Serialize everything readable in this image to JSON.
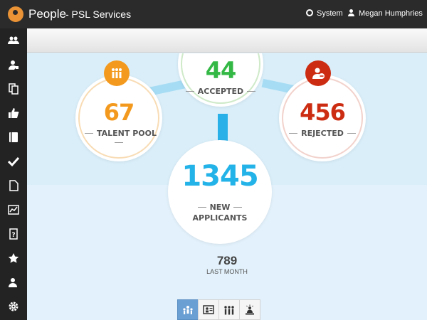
{
  "header": {
    "app_name": "People",
    "org_name": "- PSL Services",
    "system_label": "System",
    "user_name": "Megan Humphries"
  },
  "sidebar": {
    "items": [
      {
        "icon": "users-group-icon"
      },
      {
        "icon": "user-settings-icon"
      },
      {
        "icon": "copy-documents-icon"
      },
      {
        "icon": "thumbs-up-icon"
      },
      {
        "icon": "book-icon"
      },
      {
        "icon": "checkmark-icon"
      },
      {
        "icon": "document-icon"
      },
      {
        "icon": "line-chart-icon"
      },
      {
        "icon": "help-document-icon"
      },
      {
        "icon": "star-icon"
      },
      {
        "icon": "user-add-icon"
      },
      {
        "icon": "gear-icon"
      }
    ]
  },
  "stats": {
    "accepted": {
      "value": "44",
      "label": "ACCEPTED",
      "color": "#33b845"
    },
    "talent_pool": {
      "value": "67",
      "label": "TALENT POOL",
      "color": "#f39a1e"
    },
    "rejected": {
      "value": "456",
      "label": "REJECTED",
      "color": "#cc2d12"
    },
    "new_applicants": {
      "value": "1345",
      "label_line1": "NEW",
      "label_line2": "APPLICANTS",
      "color": "#24b3e8"
    },
    "last_month": {
      "value": "789",
      "label": "LAST MONTH"
    }
  },
  "view_buttons": [
    {
      "icon": "applicants-view-icon",
      "active": true
    },
    {
      "icon": "profile-card-view-icon",
      "active": false
    },
    {
      "icon": "team-view-icon",
      "active": false
    },
    {
      "icon": "presenter-view-icon",
      "active": false
    }
  ]
}
